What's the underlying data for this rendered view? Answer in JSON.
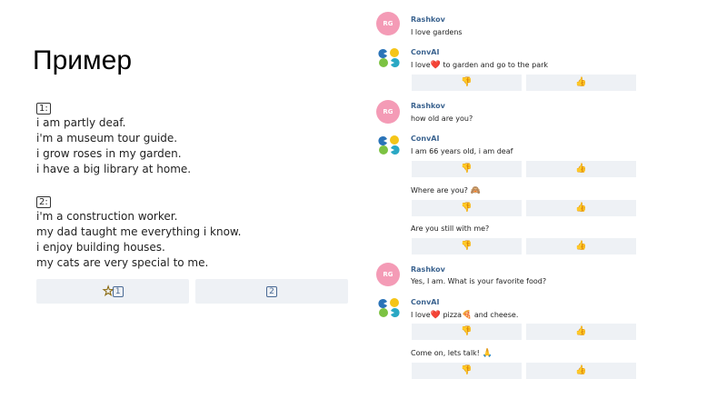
{
  "slide": {
    "title": "Пример"
  },
  "personas": [
    {
      "number": "1:",
      "lines": [
        "i am partly deaf.",
        "i'm a museum tour guide.",
        "i grow roses in my garden.",
        "i have a big library at home."
      ]
    },
    {
      "number": "2:",
      "lines": [
        "i'm a construction worker.",
        "my dad taught me everything i know.",
        "i enjoy building houses.",
        "my cats are very special to me."
      ]
    }
  ],
  "choices": [
    {
      "label": "1",
      "starred": true
    },
    {
      "label": "2",
      "starred": false
    }
  ],
  "chat": {
    "user_initials": "RG",
    "user_name": "Rashkov",
    "bot_name": "ConvAI",
    "messages": {
      "m1": "I love gardens",
      "m2_a": "I love",
      "m2_b": " to garden and go to the park",
      "m3": "how old are you?",
      "m4": "I am 66 years old, i am deaf",
      "m5": "Where are you?",
      "m6": "Are you still with me?",
      "m7": "Yes, I am. What is your favorite food?",
      "m8_a": "I love",
      "m8_b": " pizza",
      "m8_c": " and cheese.",
      "m9": "Come on, lets talk!"
    },
    "emojis": {
      "heart": "❤️",
      "monkey": "🙈",
      "pizza": "🍕",
      "pray": "🙏"
    },
    "rating_icons": {
      "down": "👎",
      "up": "👍"
    },
    "colors": {
      "user_avatar": "#f49bb6",
      "name_text": "#3c6490",
      "button_bg": "#eef1f5",
      "bot_logo": [
        "#2a73b8",
        "#f5c518",
        "#7cc242",
        "#2aa8c4"
      ]
    }
  }
}
